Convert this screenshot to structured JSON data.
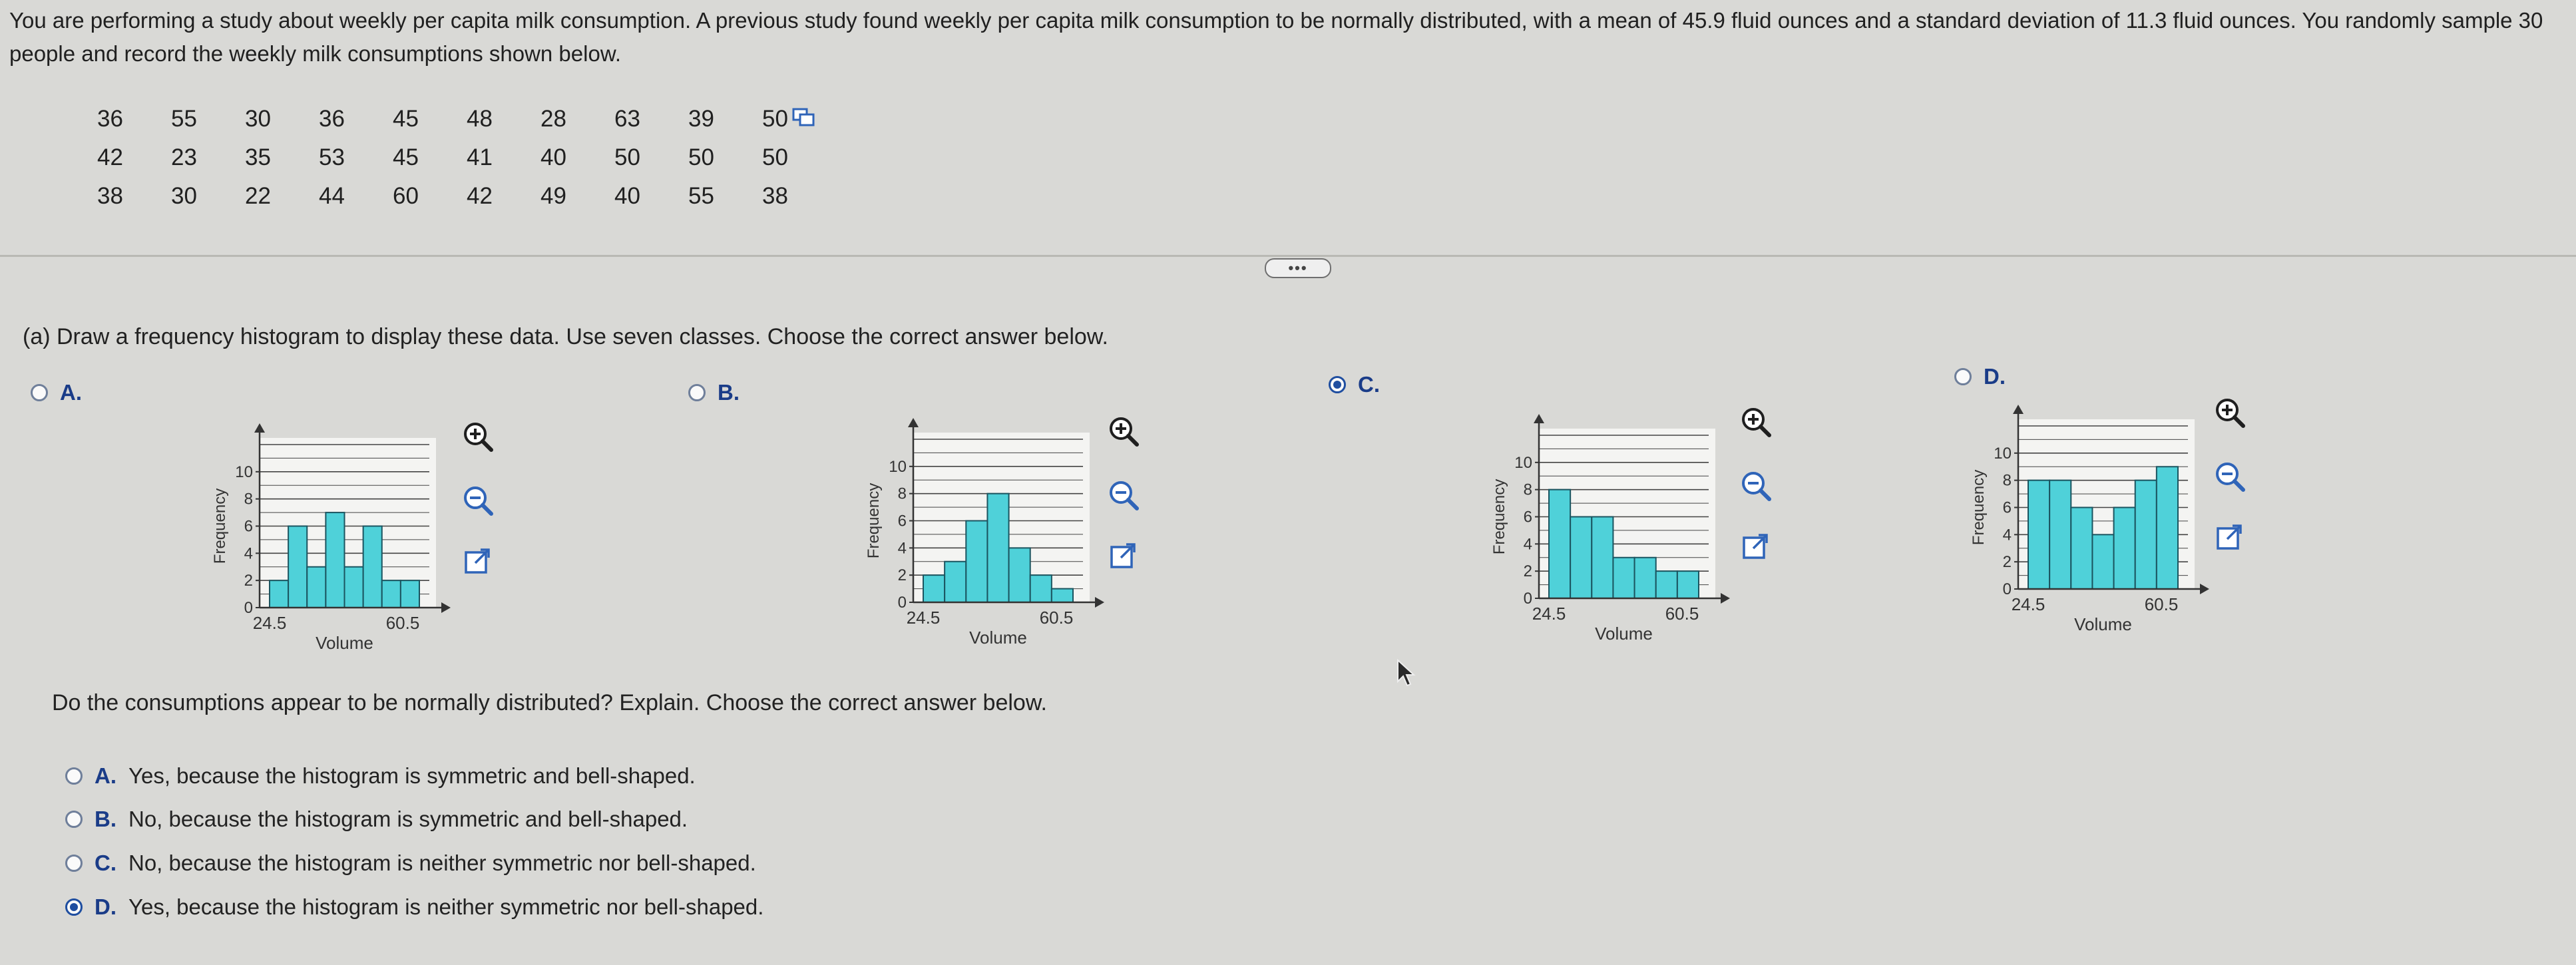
{
  "problem": {
    "text": "You are performing a study about weekly per capita milk consumption. A previous study found weekly per capita milk consumption to be normally distributed, with a mean of 45.9 fluid ounces and a standard deviation of 11.3 fluid ounces. You randomly sample 30 people and record the weekly milk consumptions shown below."
  },
  "data_rows": [
    [
      "36",
      "55",
      "30",
      "36",
      "45",
      "48",
      "28",
      "63",
      "39",
      "50"
    ],
    [
      "42",
      "23",
      "35",
      "53",
      "45",
      "41",
      "40",
      "50",
      "50",
      "50"
    ],
    [
      "38",
      "30",
      "22",
      "44",
      "60",
      "42",
      "49",
      "40",
      "55",
      "38"
    ]
  ],
  "more_label": "•••",
  "part_a": {
    "question": "(a) Draw a frequency histogram to display these data. Use seven classes. Choose the correct answer below.",
    "options": [
      {
        "letter": "A.",
        "selected": false
      },
      {
        "letter": "B.",
        "selected": false
      },
      {
        "letter": "C.",
        "selected": true
      },
      {
        "letter": "D.",
        "selected": false
      }
    ]
  },
  "histogram_labels": {
    "ylabel": "Frequency",
    "xlabel": "Volume",
    "xtick_left": "24.5",
    "xtick_right": "60.5",
    "yticks": [
      "0",
      "2",
      "4",
      "6",
      "8",
      "10"
    ]
  },
  "chart_data": [
    {
      "type": "bar",
      "option": "A",
      "xlabel": "Volume",
      "ylabel": "Frequency",
      "ylim": [
        0,
        12
      ],
      "xticks": [
        "24.5",
        "60.5"
      ],
      "values": [
        2,
        6,
        3,
        7,
        3,
        6,
        2,
        2
      ]
    },
    {
      "type": "bar",
      "option": "B",
      "xlabel": "Volume",
      "ylabel": "Frequency",
      "ylim": [
        0,
        12
      ],
      "xticks": [
        "24.5",
        "60.5"
      ],
      "values": [
        2,
        3,
        6,
        8,
        4,
        2,
        1
      ]
    },
    {
      "type": "bar",
      "option": "C",
      "xlabel": "Volume",
      "ylabel": "Frequency",
      "ylim": [
        0,
        12
      ],
      "xticks": [
        "24.5",
        "60.5"
      ],
      "values": [
        8,
        6,
        6,
        3,
        3,
        2,
        2
      ]
    },
    {
      "type": "bar",
      "option": "D",
      "xlabel": "Volume",
      "ylabel": "Frequency",
      "ylim": [
        0,
        12
      ],
      "xticks": [
        "24.5",
        "60.5"
      ],
      "values": [
        8,
        8,
        6,
        4,
        6,
        8,
        9
      ]
    }
  ],
  "part_b": {
    "question": "Do the consumptions appear to be normally distributed? Explain. Choose the correct answer below.",
    "answers": [
      {
        "letter": "A.",
        "text": "Yes, because the histogram is symmetric and bell-shaped.",
        "selected": false
      },
      {
        "letter": "B.",
        "text": "No, because the histogram is symmetric and bell-shaped.",
        "selected": false
      },
      {
        "letter": "C.",
        "text": "No, because the histogram is neither symmetric nor bell-shaped.",
        "selected": false
      },
      {
        "letter": "D.",
        "text": "Yes, because the histogram is neither symmetric nor bell-shaped.",
        "selected": true
      }
    ]
  },
  "colors": {
    "bar_fill": "#4fd1d9",
    "bar_stroke": "#1b5560",
    "grid": "#444444",
    "accent": "#1f4ea0"
  },
  "icons": [
    "zoom-in-icon",
    "zoom-out-icon",
    "open-new-window-icon",
    "copy-icon",
    "pointer-cursor-icon"
  ]
}
